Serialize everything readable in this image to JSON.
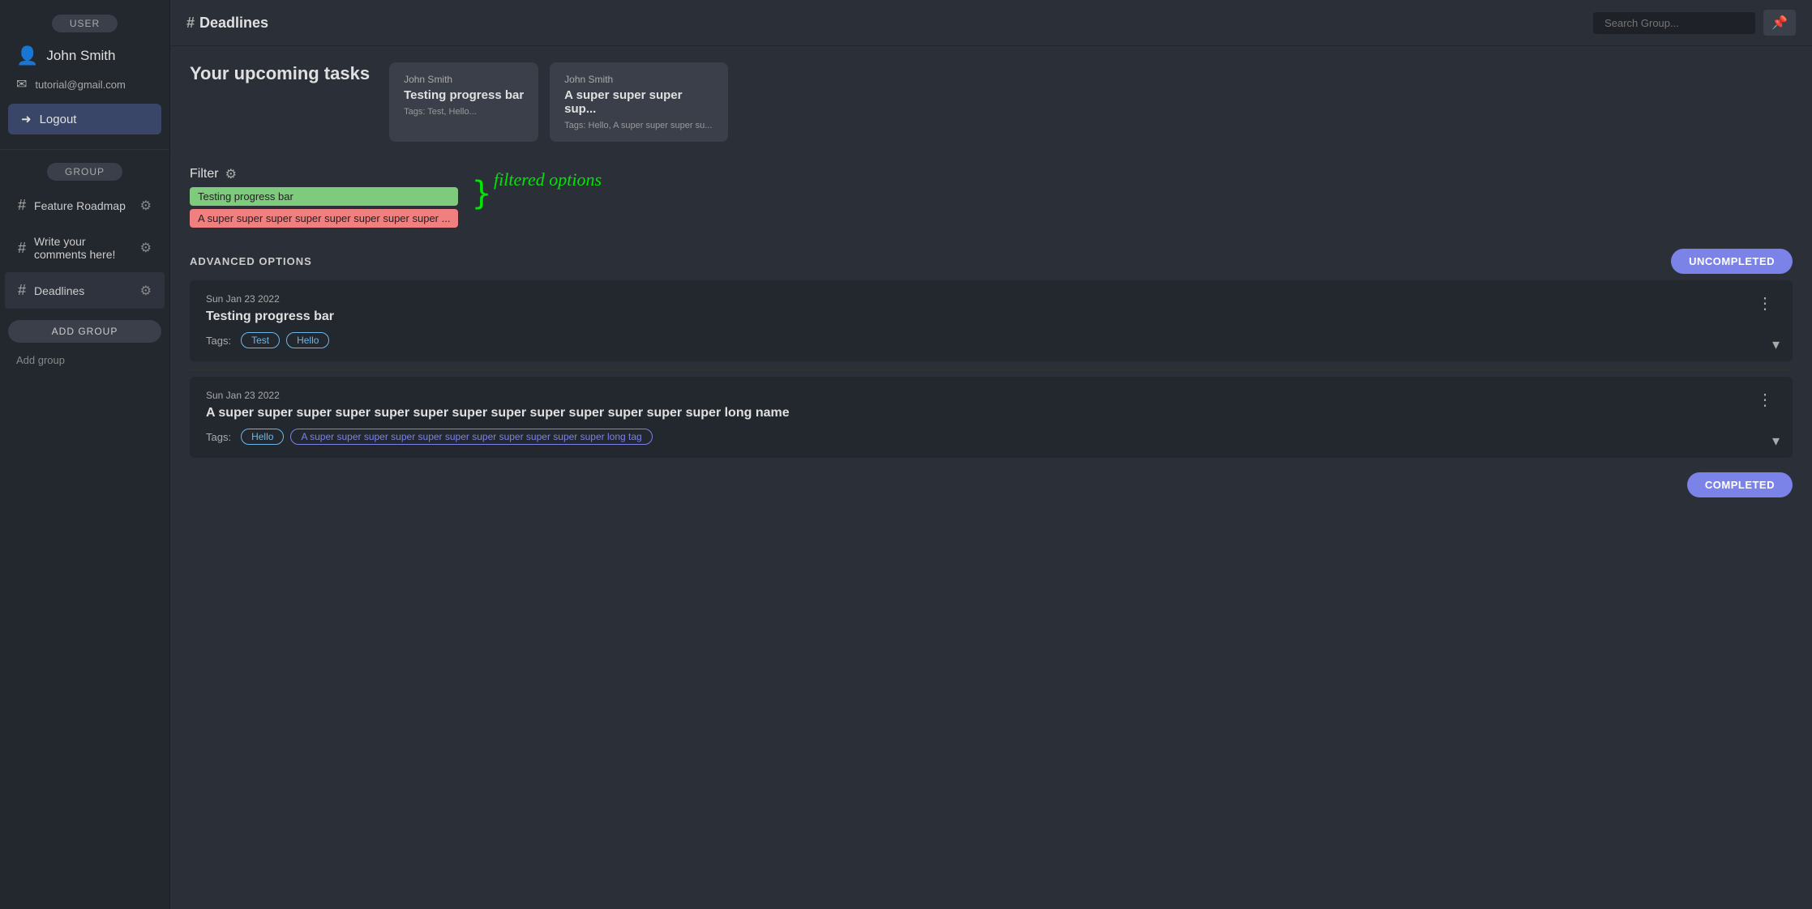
{
  "sidebar": {
    "user_badge": "USER",
    "user_name": "John Smith",
    "user_email": "tutorial@gmail.com",
    "logout_label": "Logout",
    "group_badge": "GROUP",
    "groups": [
      {
        "id": "feature-roadmap",
        "name": "Feature Roadmap"
      },
      {
        "id": "write-comments",
        "name": "Write your comments here!"
      },
      {
        "id": "deadlines",
        "name": "Deadlines",
        "active": true
      }
    ],
    "add_group_label": "ADD GROUP",
    "add_group_link": "Add group"
  },
  "topbar": {
    "title": "Deadlines",
    "hash": "#",
    "search_placeholder": "Search Group...",
    "icon": "📌"
  },
  "upcoming": {
    "title": "Your upcoming tasks",
    "cards": [
      {
        "author": "John Smith",
        "title": "Testing progress bar",
        "tags": "Tags: Test, Hello..."
      },
      {
        "author": "John Smith",
        "title": "A super super super sup...",
        "tags": "Tags: Hello, A super super super su..."
      }
    ]
  },
  "filter": {
    "label": "Filter",
    "options": [
      {
        "text": "Testing progress bar",
        "selected": true
      },
      {
        "text": "A super super super super super super super super ...",
        "selected": false
      }
    ],
    "annotation": "filtered options"
  },
  "advanced_options_label": "ADVANCED OPTIONS",
  "status_uncompleted": "UNCOMPLETED",
  "status_completed": "COMPLETED",
  "tasks": [
    {
      "date": "Sun Jan 23 2022",
      "title": "Testing progress bar",
      "tags_label": "Tags:",
      "tags": [
        {
          "text": "Test",
          "type": "normal"
        },
        {
          "text": "Hello",
          "type": "normal"
        }
      ]
    },
    {
      "date": "Sun Jan 23 2022",
      "title": "A super super super super super super super super super super super super super long name",
      "tags_label": "Tags:",
      "tags": [
        {
          "text": "Hello",
          "type": "normal"
        },
        {
          "text": "A super super super super super super super super super super super long tag",
          "type": "long"
        }
      ]
    }
  ]
}
